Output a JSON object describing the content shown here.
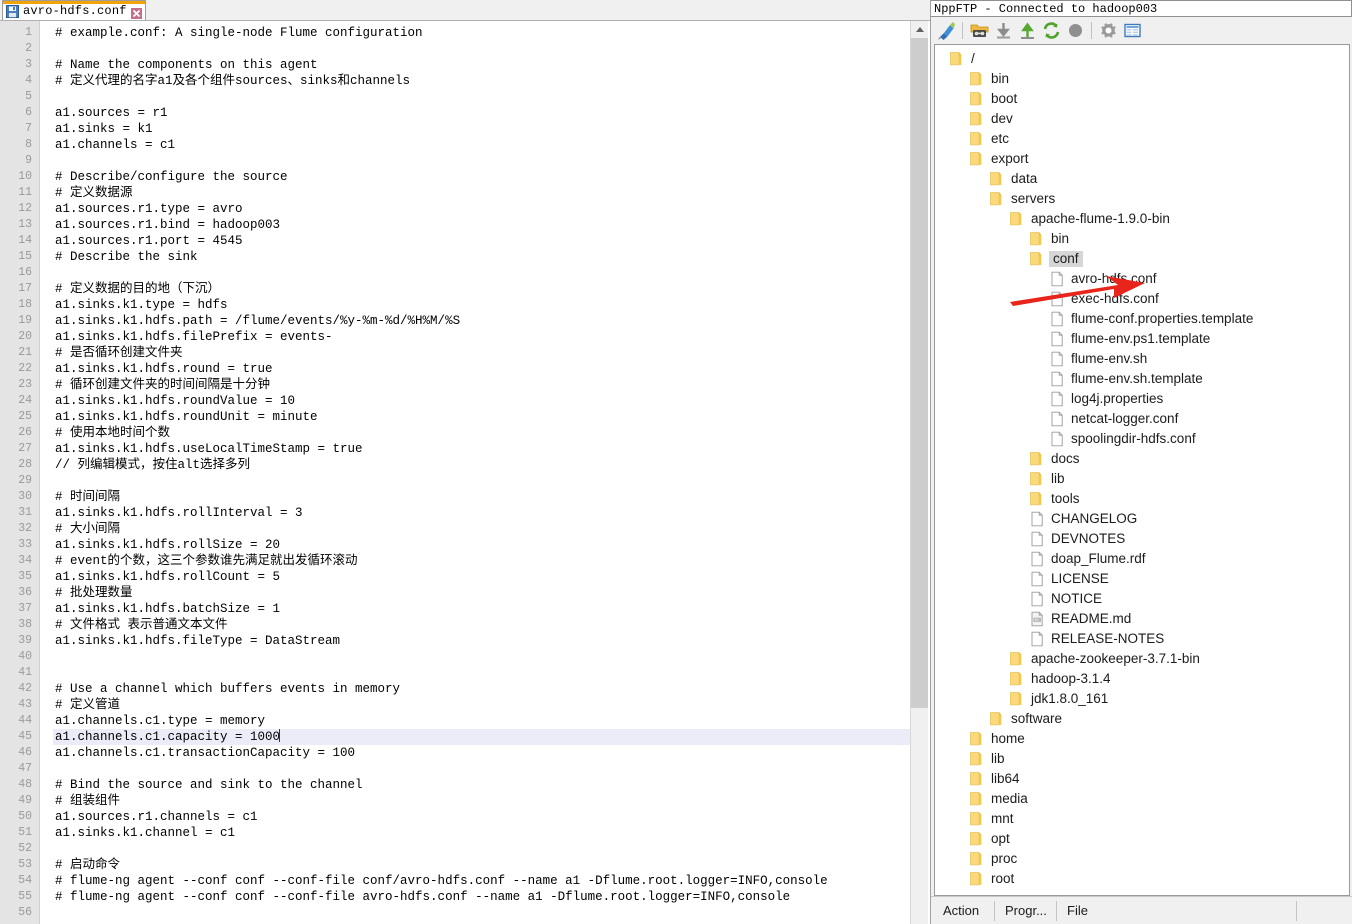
{
  "editor": {
    "tab": {
      "label": "avro-hdfs.conf",
      "save_icon": "floppy-save-icon",
      "close_icon": "close-icon"
    },
    "current_line": 45,
    "code_lines": [
      {
        "n": 1,
        "text": "# example.conf: A single-node Flume configuration"
      },
      {
        "n": 2,
        "text": ""
      },
      {
        "n": 3,
        "text": "# Name the components on this agent"
      },
      {
        "n": 4,
        "text": "# 定义代理的名字a1及各个组件sources、sinks和channels"
      },
      {
        "n": 5,
        "text": ""
      },
      {
        "n": 6,
        "text": "a1.sources = r1"
      },
      {
        "n": 7,
        "text": "a1.sinks = k1"
      },
      {
        "n": 8,
        "text": "a1.channels = c1"
      },
      {
        "n": 9,
        "text": ""
      },
      {
        "n": 10,
        "text": "# Describe/configure the source"
      },
      {
        "n": 11,
        "text": "# 定义数据源"
      },
      {
        "n": 12,
        "text": "a1.sources.r1.type = avro"
      },
      {
        "n": 13,
        "text": "a1.sources.r1.bind = hadoop003"
      },
      {
        "n": 14,
        "text": "a1.sources.r1.port = 4545"
      },
      {
        "n": 15,
        "text": "# Describe the sink"
      },
      {
        "n": 16,
        "text": ""
      },
      {
        "n": 17,
        "text": "# 定义数据的目的地（下沉）"
      },
      {
        "n": 18,
        "text": "a1.sinks.k1.type = hdfs"
      },
      {
        "n": 19,
        "text": "a1.sinks.k1.hdfs.path = /flume/events/%y-%m-%d/%H%M/%S"
      },
      {
        "n": 20,
        "text": "a1.sinks.k1.hdfs.filePrefix = events-"
      },
      {
        "n": 21,
        "text": "# 是否循环创建文件夹"
      },
      {
        "n": 22,
        "text": "a1.sinks.k1.hdfs.round = true"
      },
      {
        "n": 23,
        "text": "# 循环创建文件夹的时间间隔是十分钟"
      },
      {
        "n": 24,
        "text": "a1.sinks.k1.hdfs.roundValue = 10"
      },
      {
        "n": 25,
        "text": "a1.sinks.k1.hdfs.roundUnit = minute"
      },
      {
        "n": 26,
        "text": "# 使用本地时间个数"
      },
      {
        "n": 27,
        "text": "a1.sinks.k1.hdfs.useLocalTimeStamp = true"
      },
      {
        "n": 28,
        "text": "// 列编辑模式，按住alt选择多列"
      },
      {
        "n": 29,
        "text": ""
      },
      {
        "n": 30,
        "text": "# 时间间隔"
      },
      {
        "n": 31,
        "text": "a1.sinks.k1.hdfs.rollInterval = 3"
      },
      {
        "n": 32,
        "text": "# 大小间隔"
      },
      {
        "n": 33,
        "text": "a1.sinks.k1.hdfs.rollSize = 20"
      },
      {
        "n": 34,
        "text": "# event的个数，这三个参数谁先满足就出发循环滚动"
      },
      {
        "n": 35,
        "text": "a1.sinks.k1.hdfs.rollCount = 5"
      },
      {
        "n": 36,
        "text": "# 批处理数量"
      },
      {
        "n": 37,
        "text": "a1.sinks.k1.hdfs.batchSize = 1"
      },
      {
        "n": 38,
        "text": "# 文件格式 表示普通文本文件"
      },
      {
        "n": 39,
        "text": "a1.sinks.k1.hdfs.fileType = DataStream"
      },
      {
        "n": 40,
        "text": ""
      },
      {
        "n": 41,
        "text": ""
      },
      {
        "n": 42,
        "text": "# Use a channel which buffers events in memory"
      },
      {
        "n": 43,
        "text": "# 定义管道"
      },
      {
        "n": 44,
        "text": "a1.channels.c1.type = memory"
      },
      {
        "n": 45,
        "text": "a1.channels.c1.capacity = 1000"
      },
      {
        "n": 46,
        "text": "a1.channels.c1.transactionCapacity = 100"
      },
      {
        "n": 47,
        "text": ""
      },
      {
        "n": 48,
        "text": "# Bind the source and sink to the channel"
      },
      {
        "n": 49,
        "text": "# 组装组件"
      },
      {
        "n": 50,
        "text": "a1.sources.r1.channels = c1"
      },
      {
        "n": 51,
        "text": "a1.sinks.k1.channel = c1"
      },
      {
        "n": 52,
        "text": ""
      },
      {
        "n": 53,
        "text": "# 启动命令"
      },
      {
        "n": 54,
        "text": "# flume-ng agent --conf conf --conf-file conf/avro-hdfs.conf --name a1 -Dflume.root.logger=INFO,console"
      },
      {
        "n": 55,
        "text": "# flume-ng agent --conf conf --conf-file avro-hdfs.conf --name a1 -Dflume.root.logger=INFO,console"
      },
      {
        "n": 56,
        "text": ""
      }
    ]
  },
  "ftp": {
    "title": "NppFTP - Connected to hadoop003",
    "toolbar": [
      {
        "name": "connect-icon",
        "title": "connect"
      },
      {
        "name": "open-directory-icon",
        "title": "open directory"
      },
      {
        "name": "download-icon",
        "title": "download"
      },
      {
        "name": "upload-icon",
        "title": "upload"
      },
      {
        "name": "refresh-icon",
        "title": "refresh"
      },
      {
        "name": "abort-icon",
        "title": "abort"
      },
      {
        "name": "settings-gear-icon",
        "title": "settings"
      },
      {
        "name": "messages-window-icon",
        "title": "messages"
      }
    ],
    "tree": [
      {
        "label": "/",
        "type": "folder",
        "depth": 0,
        "selected": false
      },
      {
        "label": "bin",
        "type": "folder",
        "depth": 1,
        "selected": false
      },
      {
        "label": "boot",
        "type": "folder",
        "depth": 1,
        "selected": false
      },
      {
        "label": "dev",
        "type": "folder",
        "depth": 1,
        "selected": false
      },
      {
        "label": "etc",
        "type": "folder",
        "depth": 1,
        "selected": false
      },
      {
        "label": "export",
        "type": "folder",
        "depth": 1,
        "selected": false
      },
      {
        "label": "data",
        "type": "folder",
        "depth": 2,
        "selected": false
      },
      {
        "label": "servers",
        "type": "folder",
        "depth": 2,
        "selected": false
      },
      {
        "label": "apache-flume-1.9.0-bin",
        "type": "folder",
        "depth": 3,
        "selected": false
      },
      {
        "label": "bin",
        "type": "folder",
        "depth": 4,
        "selected": false
      },
      {
        "label": "conf",
        "type": "folder",
        "depth": 4,
        "selected": true
      },
      {
        "label": "avro-hdfs.conf",
        "type": "file",
        "depth": 5,
        "selected": false
      },
      {
        "label": "exec-hdfs.conf",
        "type": "file",
        "depth": 5,
        "selected": false
      },
      {
        "label": "flume-conf.properties.template",
        "type": "file",
        "depth": 5,
        "selected": false
      },
      {
        "label": "flume-env.ps1.template",
        "type": "file",
        "depth": 5,
        "selected": false
      },
      {
        "label": "flume-env.sh",
        "type": "file",
        "depth": 5,
        "selected": false
      },
      {
        "label": "flume-env.sh.template",
        "type": "file",
        "depth": 5,
        "selected": false
      },
      {
        "label": "log4j.properties",
        "type": "file",
        "depth": 5,
        "selected": false
      },
      {
        "label": "netcat-logger.conf",
        "type": "file",
        "depth": 5,
        "selected": false
      },
      {
        "label": "spoolingdir-hdfs.conf",
        "type": "file",
        "depth": 5,
        "selected": false
      },
      {
        "label": "docs",
        "type": "folder",
        "depth": 4,
        "selected": false
      },
      {
        "label": "lib",
        "type": "folder",
        "depth": 4,
        "selected": false
      },
      {
        "label": "tools",
        "type": "folder",
        "depth": 4,
        "selected": false
      },
      {
        "label": "CHANGELOG",
        "type": "file",
        "depth": 4,
        "selected": false
      },
      {
        "label": "DEVNOTES",
        "type": "file",
        "depth": 4,
        "selected": false
      },
      {
        "label": "doap_Flume.rdf",
        "type": "file",
        "depth": 4,
        "selected": false
      },
      {
        "label": "LICENSE",
        "type": "file",
        "depth": 4,
        "selected": false
      },
      {
        "label": "NOTICE",
        "type": "file",
        "depth": 4,
        "selected": false
      },
      {
        "label": "README.md",
        "type": "markdown",
        "depth": 4,
        "selected": false
      },
      {
        "label": "RELEASE-NOTES",
        "type": "file",
        "depth": 4,
        "selected": false
      },
      {
        "label": "apache-zookeeper-3.7.1-bin",
        "type": "folder",
        "depth": 3,
        "selected": false
      },
      {
        "label": "hadoop-3.1.4",
        "type": "folder",
        "depth": 3,
        "selected": false
      },
      {
        "label": "jdk1.8.0_161",
        "type": "folder",
        "depth": 3,
        "selected": false
      },
      {
        "label": "software",
        "type": "folder",
        "depth": 2,
        "selected": false
      },
      {
        "label": "home",
        "type": "folder",
        "depth": 1,
        "selected": false
      },
      {
        "label": "lib",
        "type": "folder",
        "depth": 1,
        "selected": false
      },
      {
        "label": "lib64",
        "type": "folder",
        "depth": 1,
        "selected": false
      },
      {
        "label": "media",
        "type": "folder",
        "depth": 1,
        "selected": false
      },
      {
        "label": "mnt",
        "type": "folder",
        "depth": 1,
        "selected": false
      },
      {
        "label": "opt",
        "type": "folder",
        "depth": 1,
        "selected": false
      },
      {
        "label": "proc",
        "type": "folder",
        "depth": 1,
        "selected": false
      },
      {
        "label": "root",
        "type": "folder",
        "depth": 1,
        "selected": false
      }
    ],
    "status_columns": [
      "Action",
      "Progr...",
      "File"
    ]
  },
  "annotation": {
    "arrow_color": "#e8251a",
    "points_at": "avro-hdfs.conf"
  },
  "colors": {
    "tab_accent": "#f0a30a",
    "folder": "#f5d06a",
    "current_line": "#ececf8",
    "gutter_bg": "#e4e4e4"
  }
}
